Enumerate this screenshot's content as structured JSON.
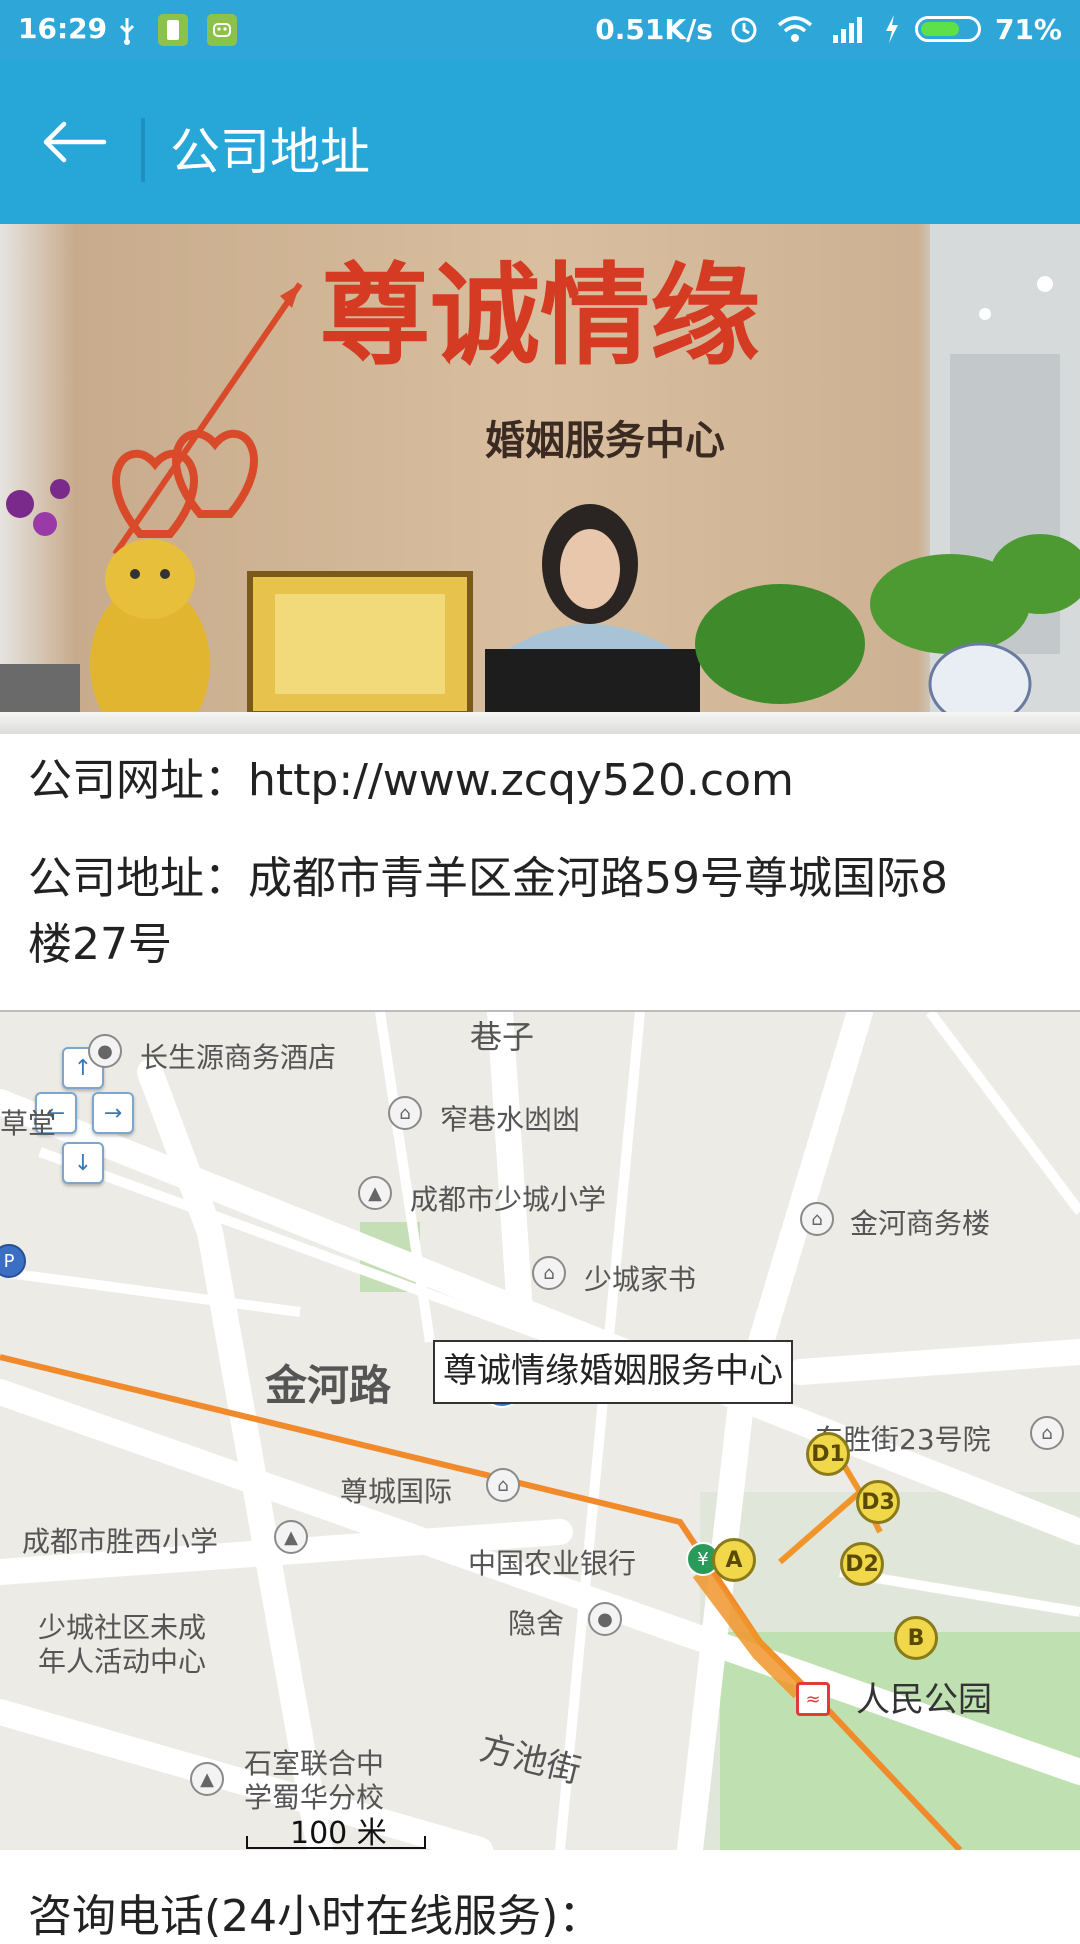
{
  "status_bar": {
    "time": "16:29",
    "speed": "0.51K/s",
    "battery": "71%",
    "battery_level": 0.71,
    "icons": [
      "usb-icon",
      "battery-saver-icon",
      "android-icon",
      "alarm-icon",
      "wifi-icon",
      "signal-icon",
      "charging-icon"
    ]
  },
  "app_bar": {
    "title": "公司地址",
    "back_icon": "arrow-left-icon"
  },
  "photo": {
    "sign_main": "尊诚情缘",
    "sign_sub": "婚姻服务中心"
  },
  "info": {
    "website": "公司网址：http://www.zcqy520.com",
    "address_line1": "公司地址：成都市青羊区金河路59号尊城国际8",
    "address_line2": "楼27号"
  },
  "map": {
    "callout": "尊诚情缘婚姻服务中心",
    "labels": {
      "hotel": "长生源商务酒店",
      "xianghsui": "窄巷水凼凼",
      "school1": "成都市少城小学",
      "jinhe_building": "金河商务楼",
      "shaocheng_books": "少城家书",
      "road_jinhe": "金河路",
      "dongsheng": "东胜街23号院",
      "zuncheng": "尊城国际",
      "school2": "成都市胜西小学",
      "bank": "中国农业银行",
      "yinshe": "隐舍",
      "youth1": "少城社区未成",
      "youth2": "年人活动中心",
      "people_park": "人民公园",
      "fangchi": "方池街",
      "shishi1": "石室联合中",
      "shishi2": "学蜀华分校",
      "alley_top": "巷子",
      "left_edge": "草堂"
    },
    "metro_exits": [
      "D1",
      "D3",
      "D2",
      "A",
      "B"
    ],
    "scale_label": "100 米"
  },
  "footer": {
    "consult": "咨询电话(24小时在线服务)："
  }
}
